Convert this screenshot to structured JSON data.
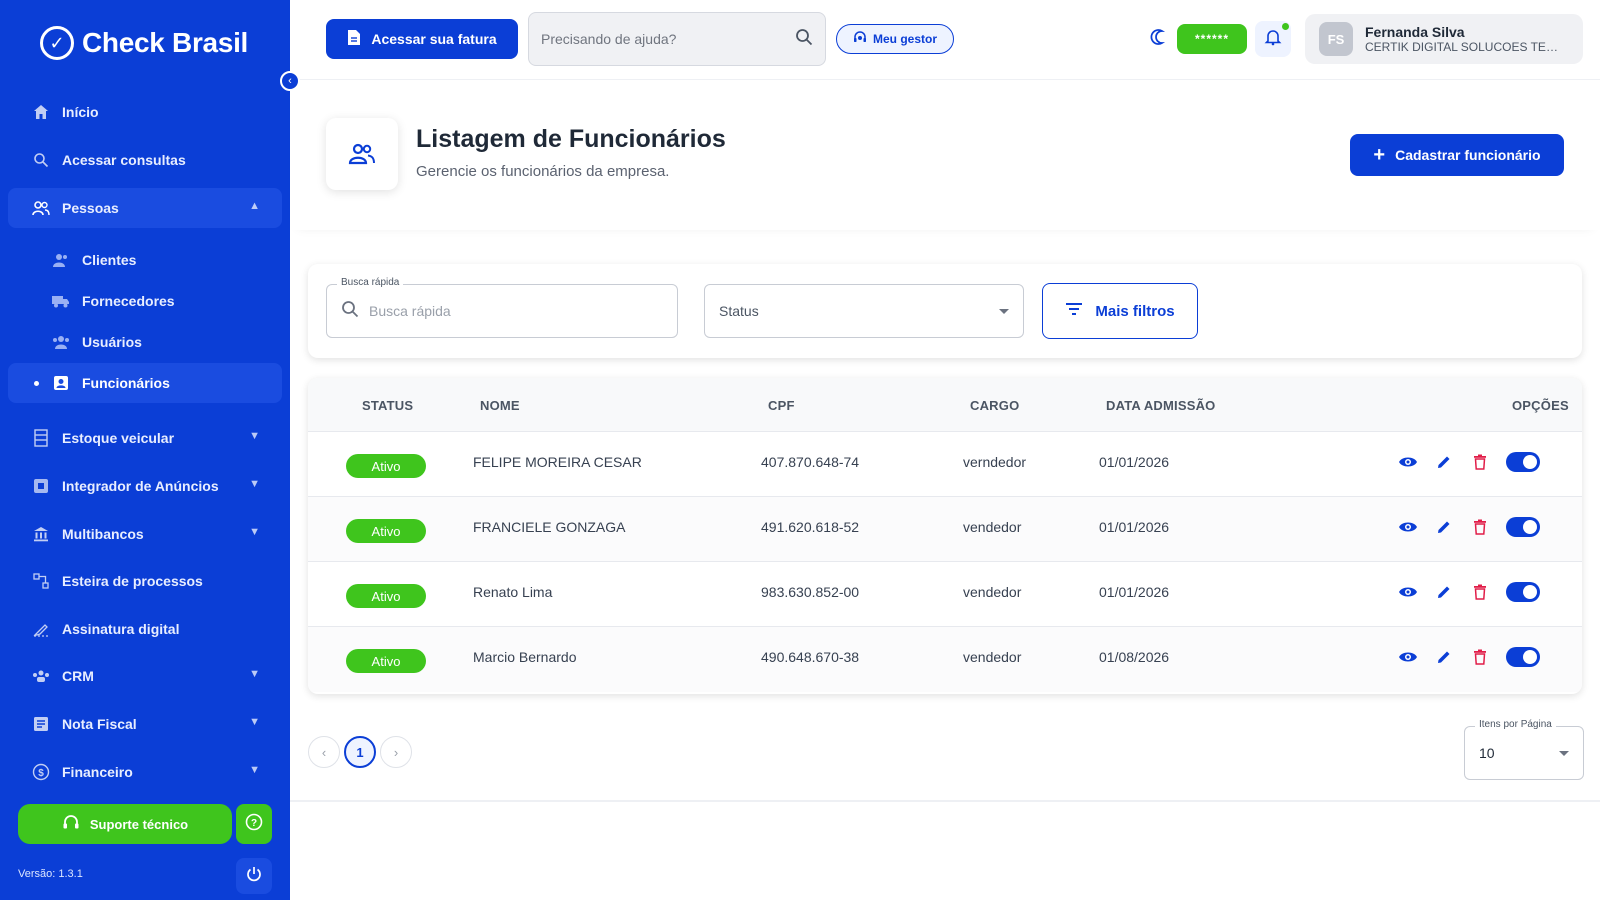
{
  "sidebar": {
    "brand": "Check Brasil",
    "items": [
      {
        "label": "Início"
      },
      {
        "label": "Acessar consultas"
      },
      {
        "label": "Pessoas"
      },
      {
        "label": "Clientes"
      },
      {
        "label": "Fornecedores"
      },
      {
        "label": "Usuários"
      },
      {
        "label": "Funcionários"
      },
      {
        "label": "Estoque veicular"
      },
      {
        "label": "Integrador de Anúncios"
      },
      {
        "label": "Multibancos"
      },
      {
        "label": "Esteira de processos"
      },
      {
        "label": "Assinatura digital"
      },
      {
        "label": "CRM"
      },
      {
        "label": "Nota Fiscal"
      },
      {
        "label": "Financeiro"
      }
    ],
    "support_label": "Suporte técnico",
    "version": "Versão: 1.3.1"
  },
  "topbar": {
    "fatura_label": "Acessar sua fatura",
    "help_placeholder": "Precisando de ajuda?",
    "gestor_label": "Meu gestor",
    "hidden_value": "******",
    "user": {
      "initials": "FS",
      "name": "Fernanda Silva",
      "company": "CERTIK DIGITAL SOLUCOES TECNOLOGICAS"
    }
  },
  "page": {
    "title": "Listagem de Funcionários",
    "subtitle": "Gerencie os funcionários da empresa.",
    "add_button": "Cadastrar funcionário"
  },
  "filters": {
    "quick_search_legend": "Busca rápida",
    "quick_search_placeholder": "Busca rápida",
    "status_placeholder": "Status",
    "more_filters": "Mais filtros"
  },
  "table": {
    "headers": [
      "STATUS",
      "NOME",
      "CPF",
      "CARGO",
      "DATA ADMISSÃO",
      "OPÇÕES"
    ],
    "rows": [
      {
        "status": "Ativo",
        "nome": "FELIPE MOREIRA CESAR",
        "cpf": "407.870.648-74",
        "cargo": "verndedor",
        "admissao": "01/01/2026"
      },
      {
        "status": "Ativo",
        "nome": "FRANCIELE GONZAGA",
        "cpf": "491.620.618-52",
        "cargo": "vendedor",
        "admissao": "01/01/2026"
      },
      {
        "status": "Ativo",
        "nome": "Renato Lima",
        "cpf": "983.630.852-00",
        "cargo": "vendedor",
        "admissao": "01/01/2026"
      },
      {
        "status": "Ativo",
        "nome": "Marcio Bernardo",
        "cpf": "490.648.670-38",
        "cargo": "vendedor",
        "admissao": "01/08/2026"
      }
    ]
  },
  "pagination": {
    "current_page": "1",
    "per_page_legend": "Itens por Página",
    "per_page": "10"
  },
  "colors": {
    "primary": "#0b3ed6",
    "success": "#3fc51d",
    "danger": "#e11d48"
  }
}
